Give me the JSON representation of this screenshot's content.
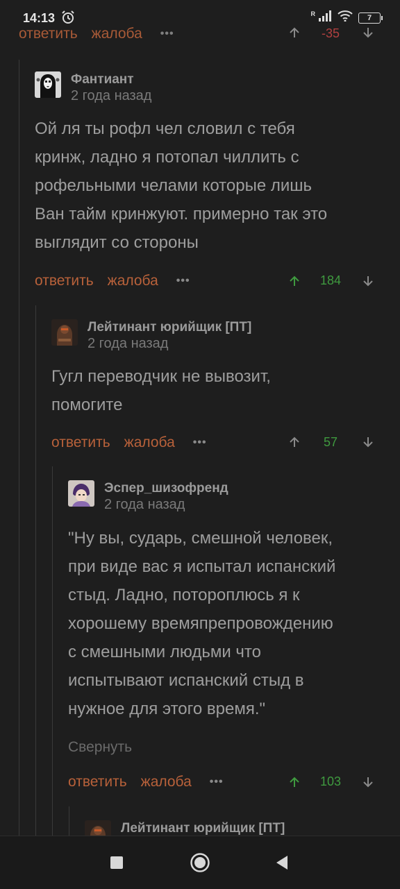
{
  "status_bar": {
    "time": "14:13",
    "signal_label": "R",
    "battery": "7"
  },
  "actions": {
    "reply": "ответить",
    "report": "жалоба",
    "more": "•••"
  },
  "top_partial": {
    "score": "-35"
  },
  "comments": [
    {
      "author": "Фантиант",
      "time": "2 года назад",
      "lines": [
        "Ой ля ты рофл чел словил с тебя",
        "кринж, ладно я потопал чиллить с",
        "рофельными челами которые лишь",
        "Ван тайм кринжуют. примерно так это",
        "выглядит со стороны"
      ],
      "score": "184"
    },
    {
      "author": "Лейтинант юрийщик [ПТ]",
      "time": "2 года назад",
      "lines": [
        "Гугл переводчик не вывозит,",
        "помогите"
      ],
      "score": "57"
    },
    {
      "author": "Эспер_шизофренд",
      "time": "2 года назад",
      "lines": [
        "\"Ну вы, сударь, смешной человек,",
        "при виде вас я испытал испанский",
        "стыд. Ладно, потороплюсь я к",
        "хорошему времяпрепровождению",
        "с смешными людьми что",
        "испытывают испанский стыд в",
        "нужное для этого время.\""
      ],
      "collapse": "Свернуть",
      "score": "103"
    },
    {
      "author": "Лейтинант юрийщик [ПТ]"
    }
  ],
  "icons": {
    "alarm": "alarm-clock-icon",
    "wifi": "wifi-icon",
    "upvote": "arrow-up-icon",
    "downvote": "arrow-down-icon",
    "recents": "square-icon",
    "home": "circle-icon",
    "back": "triangle-back-icon"
  },
  "colors": {
    "background": "#1e1e1e",
    "action": "#b8613a",
    "positive": "#3f9a3f",
    "negative": "#b04040"
  }
}
